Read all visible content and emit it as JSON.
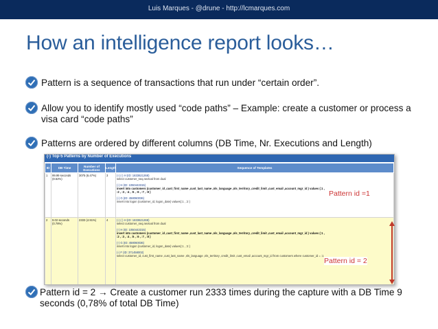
{
  "header": {
    "credit": "Luis Marques - @drune - http://lcmarques.com"
  },
  "slide": {
    "title": "How an intelligence report looks…"
  },
  "bullets": [
    "Pattern is a sequence of transactions that run under “certain order”.",
    "Allow you to identify mostly used “code paths” – Example: create a customer or process a visa card “code paths”",
    "Patterns are ordered by different columns (DB Time, Nr. Executions and Length)",
    "Pattern id = 2 → Create a customer run 2333 times during the capture with a DB Time 9 seconds (0,78% of total DB Time)"
  ],
  "report": {
    "panel_title": "(-) Top-5 Patterns by Number of Executions",
    "columns": [
      "ID",
      "DB Time",
      "Number of Executions",
      "Length",
      "Sequence of Templates"
    ],
    "rows": [
      {
        "id": "1",
        "db_time": "99.99 seconds (8.62%)",
        "executions": "3075 (6.47%)",
        "length": "3",
        "templates": [
          {
            "head": "(-) (-) H (ID: 1833621268)",
            "body": [
              "select customer_seq.nextval from dual"
            ]
          },
          {
            "head": "(-) H (ID: 1050443315)",
            "body": [
              "insert into customers (customer_id ,cust_first_name ,cust_last_name ,nls_language ,nls_territory ,credit_limit ,cust_email ,account_mgr_id ) values (:1 ,",
              ":2 , :3 , :4 , :5 , :6 , :7 , :8 )"
            ]
          },
          {
            "head": "(-) G (ID: 458060036)",
            "body": [
              "insert into logon (customer_id, logon_date) values(:1 , :2 )"
            ]
          }
        ]
      },
      {
        "id": "2",
        "db_time": "9.02 seconds (0.78%)",
        "executions": "2333 (4.91%)",
        "length": "4",
        "templates": [
          {
            "head": "(-) (-) H (ID: 1833621268)",
            "body": [
              "select customer_seq.nextval from dual"
            ]
          },
          {
            "head": "(-) H (ID: 1050443315)",
            "body": [
              "insert into customers (customer_id ,cust_first_name ,cust_last_name ,nls_language ,nls_territory ,credit_limit ,cust_email ,account_mgr_id ) values (:1 ,",
              ":2 , :3 , :4 , :5 , :6 , :7 , :8 )"
            ]
          },
          {
            "head": "(-) G (ID: 458060036)",
            "body": [
              "insert into logon (customer_id, logon_date) values(:1 , :2 )"
            ]
          },
          {
            "head": "(-) F (ID: 371458002)",
            "body": [
              "select customer_id, cust_first_name ,cust_last_name ,nls_language ,nls_territory ,credit_limit ,cust_email ,account_mgr_id from customers where customer_id = :1"
            ]
          }
        ]
      }
    ]
  },
  "annotations": {
    "pattern1": "Pattern id =1",
    "pattern2": "Pattern id = 2"
  },
  "colors": {
    "title": "#2a5d9a",
    "topbar": "#0a2a5c",
    "annotation": "#cc3333",
    "row2_bg": "#fdfbc9"
  }
}
